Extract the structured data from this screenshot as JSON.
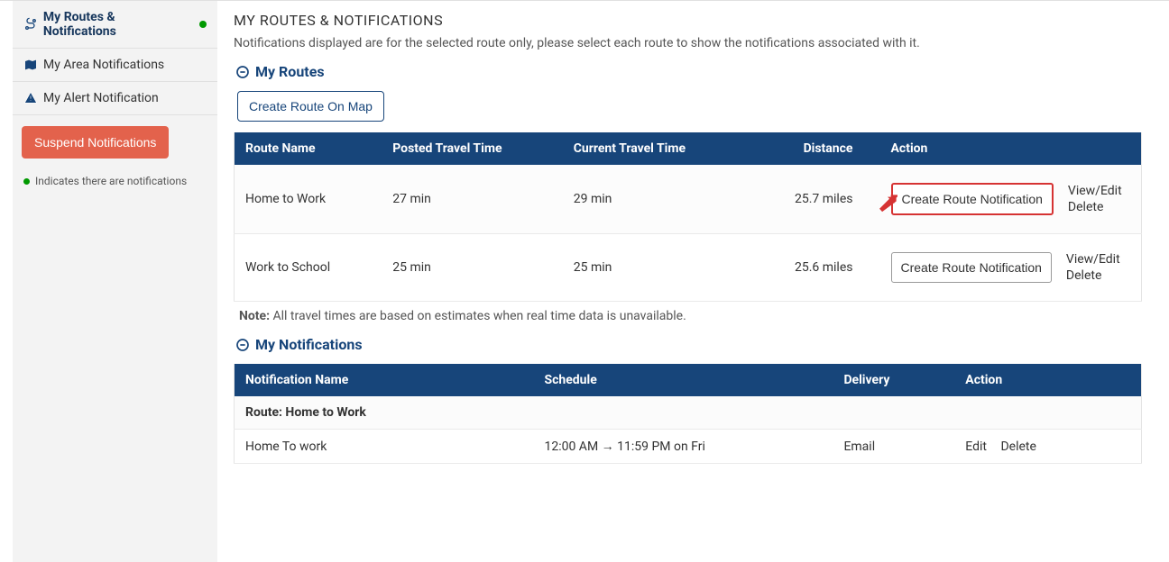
{
  "sidebar": {
    "items": [
      {
        "label": "My Routes & Notifications",
        "icon": "route",
        "has_dot": true
      },
      {
        "label": "My Area Notifications",
        "icon": "map"
      },
      {
        "label": "My Alert Notification",
        "icon": "alert"
      }
    ],
    "suspend_button": "Suspend Notifications",
    "indicator_note": "Indicates there are notifications"
  },
  "main": {
    "title": "MY ROUTES & NOTIFICATIONS",
    "subtitle": "Notifications displayed are for the selected route only, please select each route to show the notifications associated with it.",
    "routes_header": "My Routes",
    "create_route_btn": "Create Route On Map",
    "routes_columns": {
      "name": "Route Name",
      "posted": "Posted Travel Time",
      "current": "Current Travel Time",
      "distance": "Distance",
      "action": "Action"
    },
    "routes": [
      {
        "name": "Home to Work",
        "posted": "27 min",
        "current": "29 min",
        "distance": "25.7 miles",
        "highlight": true
      },
      {
        "name": "Work to School",
        "posted": "25 min",
        "current": "25 min",
        "distance": "25.6 miles",
        "highlight": false
      }
    ],
    "route_action_btn": "Create Route Notification",
    "route_action_links": {
      "view": "View/Edit",
      "delete": "Delete"
    },
    "note_label": "Note:",
    "note_text": " All travel times are based on estimates when real time data is unavailable.",
    "notifications_header": "My Notifications",
    "notifications_columns": {
      "name": "Notification Name",
      "schedule": "Schedule",
      "delivery": "Delivery",
      "action": "Action"
    },
    "notification_group": "Route: Home to Work",
    "notification_rows": [
      {
        "name": "Home To work",
        "schedule": "12:00 AM → 11:59 PM on Fri",
        "delivery": "Email"
      }
    ],
    "notif_action_links": {
      "edit": "Edit",
      "delete": "Delete"
    }
  }
}
